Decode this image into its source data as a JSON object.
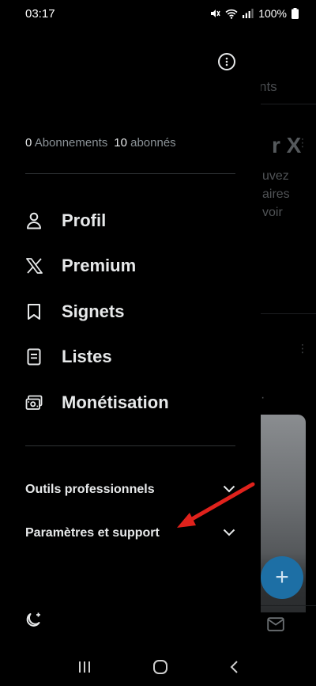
{
  "status": {
    "time": "03:17",
    "battery": "100%"
  },
  "background_feed": {
    "tab_partial": "nts",
    "headline_partial": "r X",
    "text_lines": [
      "uvez",
      "aires",
      "voir"
    ],
    "more_glyph": "⋮",
    "fab_glyph": "+"
  },
  "drawer": {
    "more_icon": "more-circle-icon",
    "following_count": "0",
    "following_label": "Abonnements",
    "followers_count": "10",
    "followers_label": "abonnés",
    "nav_items": [
      {
        "label": "Profil",
        "icon": "person-icon"
      },
      {
        "label": "Premium",
        "icon": "x-logo-icon"
      },
      {
        "label": "Signets",
        "icon": "bookmark-icon"
      },
      {
        "label": "Listes",
        "icon": "list-icon"
      },
      {
        "label": "Monétisation",
        "icon": "money-icon"
      }
    ],
    "sections": [
      {
        "label": "Outils professionnels"
      },
      {
        "label": "Paramètres et support"
      }
    ],
    "theme_icon": "moon-sparkle-icon"
  },
  "colors": {
    "background": "#000000",
    "text": "#e7e9ea",
    "muted": "#8b9297",
    "divider": "#2f3336",
    "fab": "#1d6fa5",
    "annotation_arrow": "#e0221c"
  }
}
